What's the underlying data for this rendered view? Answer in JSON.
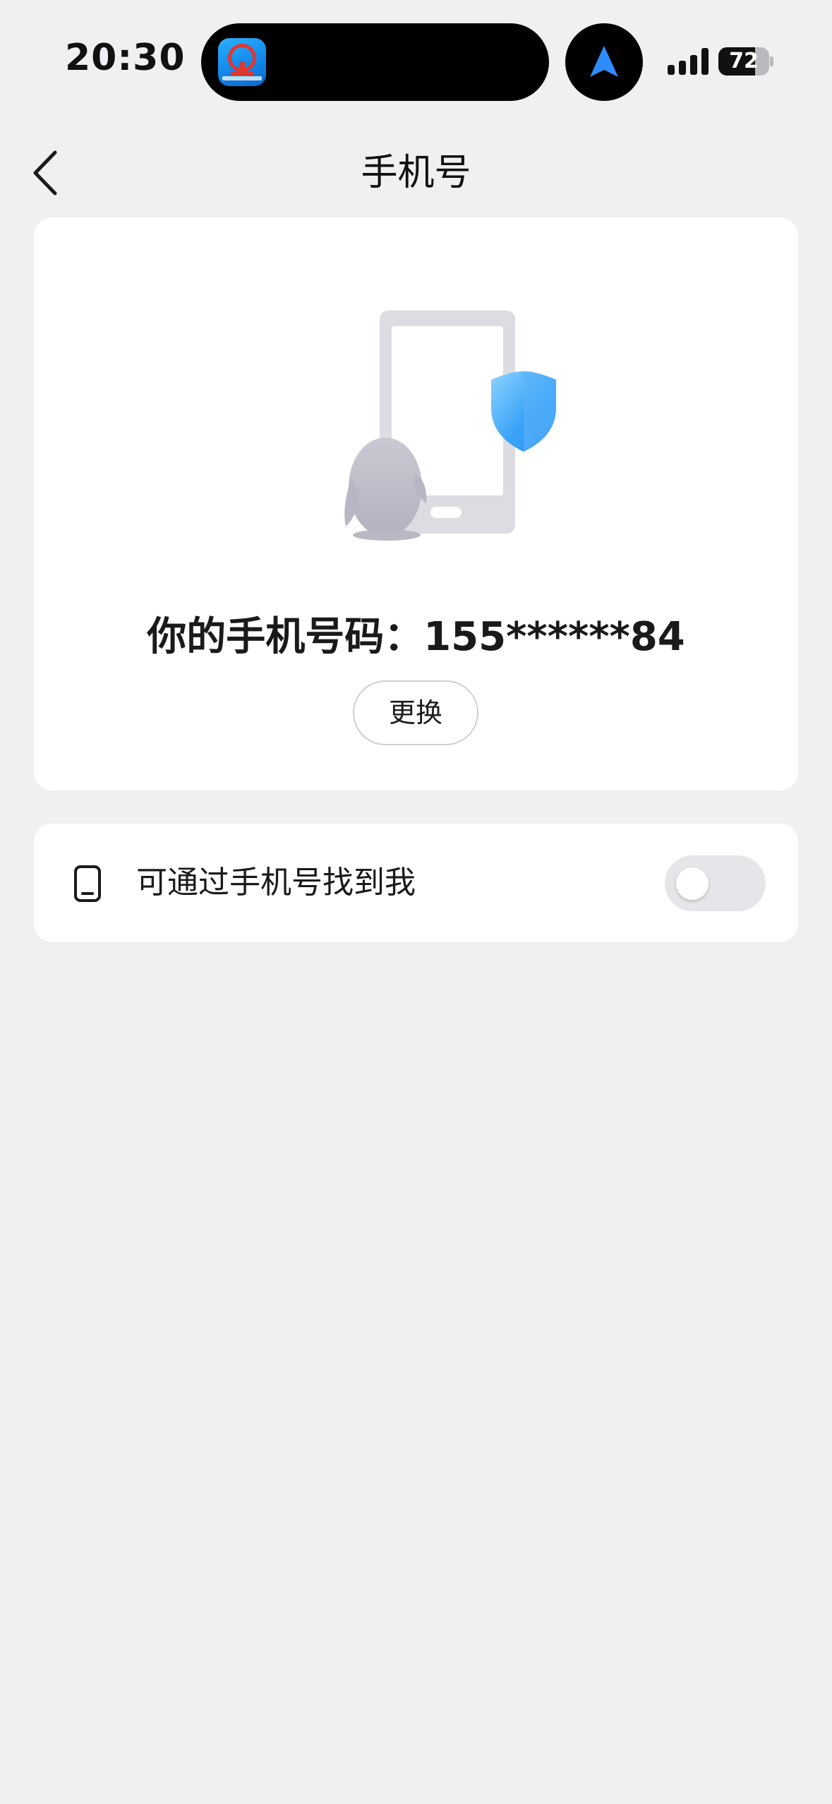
{
  "status_bar": {
    "time": "20:30",
    "battery_percent": "72",
    "battery_level": 0.72,
    "island_app_icon": "railway-app-icon",
    "location_icon": "navigation-arrow-icon",
    "signal_icon": "cellular-signal-icon"
  },
  "nav": {
    "title": "手机号",
    "back_icon": "chevron-left-icon"
  },
  "phone_card": {
    "illustration": "phone-penguin-shield-illustration",
    "phone_text": "你的手机号码：155******84",
    "change_label": "更换"
  },
  "find_card": {
    "icon": "mobile-phone-icon",
    "label": "可通过手机号找到我",
    "toggle_on": false
  },
  "colors": {
    "background": "#f0f0f3",
    "card": "#ffffff",
    "shield_blue": "#3aa4f7",
    "toggle_off": "#e6e6ea"
  }
}
